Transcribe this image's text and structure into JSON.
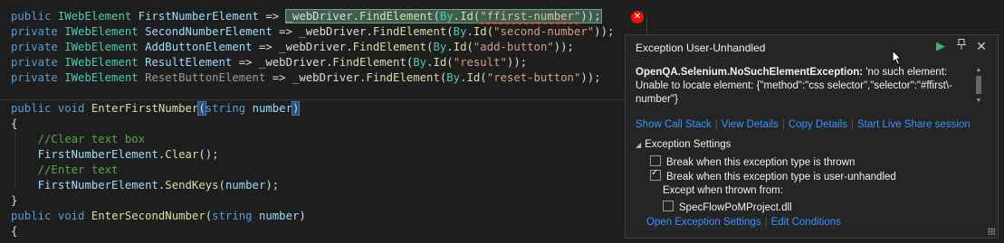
{
  "code": {
    "l1": {
      "mod": "public",
      "type": "IWebElement",
      "name": "FirstNumberElement",
      "arrow": " => ",
      "driver": "_webDriver",
      "dot1": ".",
      "find": "FindElement",
      "open": "(",
      "by": "By",
      "dot2": ".",
      "id": "Id",
      "open2": "(",
      "str": "\"ffirst-number\"",
      "close": "));"
    },
    "l2": {
      "mod": "private",
      "type": "IWebElement",
      "name": "SecondNumberElement",
      "arrow": " => ",
      "driver": "_webDriver",
      "dot1": ".",
      "find": "FindElement",
      "open": "(",
      "by": "By",
      "dot2": ".",
      "id": "Id",
      "open2": "(",
      "str": "\"second-number\"",
      "close": "));"
    },
    "l3": {
      "mod": "private",
      "type": "IWebElement",
      "name": "AddButtonElement",
      "arrow": " => ",
      "driver": "_webDriver",
      "dot1": ".",
      "find": "FindElement",
      "open": "(",
      "by": "By",
      "dot2": ".",
      "id": "Id",
      "open2": "(",
      "str": "\"add-button\"",
      "close": "));"
    },
    "l4": {
      "mod": "private",
      "type": "IWebElement",
      "name": "ResultElement",
      "arrow": " => ",
      "driver": "_webDriver",
      "dot1": ".",
      "find": "FindElement",
      "open": "(",
      "by": "By",
      "dot2": ".",
      "id": "Id",
      "open2": "(",
      "str": "\"result\"",
      "close": "));"
    },
    "l5": {
      "mod": "private",
      "type": "IWebElement",
      "name": "ResetButtonElement",
      "arrow": " => ",
      "driver": "_webDriver",
      "dot1": ".",
      "find": "FindElement",
      "open": "(",
      "by": "By",
      "dot2": ".",
      "id": "Id",
      "open2": "(",
      "str": "\"reset-button\"",
      "close": "));"
    },
    "l6": {
      "mod": "public",
      "void": "void",
      "name": "EnterFirstNumber",
      "open": "(",
      "ptype": "string",
      "param": "number",
      "close": ")"
    },
    "l7": "{",
    "l8": "//Clear text box",
    "l9": {
      "obj": "FirstNumberElement",
      "dot": ".",
      "call": "Clear",
      "rest": "();"
    },
    "l10": "//Enter text",
    "l11": {
      "obj": "FirstNumberElement",
      "dot": ".",
      "call": "SendKeys",
      "open": "(",
      "arg": "number",
      "rest": ");"
    },
    "l12": "}",
    "l13": {
      "mod": "public",
      "void": "void",
      "name": "EnterSecondNumber",
      "open": "(",
      "ptype": "string",
      "param": "number",
      "close": ")"
    },
    "l14": "{"
  },
  "error_glyph": "✕",
  "popup": {
    "title": "Exception User-Unhandled",
    "exception_type": "OpenQA.Selenium.NoSuchElementException:",
    "exception_message": " 'no such element: Unable to locate element: {\"method\":\"css selector\",\"selector\":\"#ffirst\\-number\"}",
    "links": [
      "Show Call Stack",
      "View Details",
      "Copy Details",
      "Start Live Share session"
    ],
    "settings_header": "Exception Settings",
    "option_thrown": "Break when this exception type is thrown",
    "option_thrown_checked": false,
    "option_unhandled": "Break when this exception type is user-unhandled",
    "option_unhandled_checked": true,
    "except_label": "Except when thrown from:",
    "module": "SpecFlowPoMProject.dll",
    "module_checked": false,
    "bottom_links": [
      "Open Exception Settings",
      "Edit Conditions"
    ]
  },
  "icons": {
    "continue": "play-icon",
    "pin": "pin-icon",
    "close": "close-icon",
    "error": "error-icon"
  },
  "colors": {
    "editor_bg": "#1e1e1e",
    "keyword": "#569cd6",
    "type": "#4ec9b0",
    "method": "#dcdcaa",
    "string": "#d69d85",
    "comment": "#57a64a",
    "link": "#3794ff",
    "error": "#e51400"
  }
}
